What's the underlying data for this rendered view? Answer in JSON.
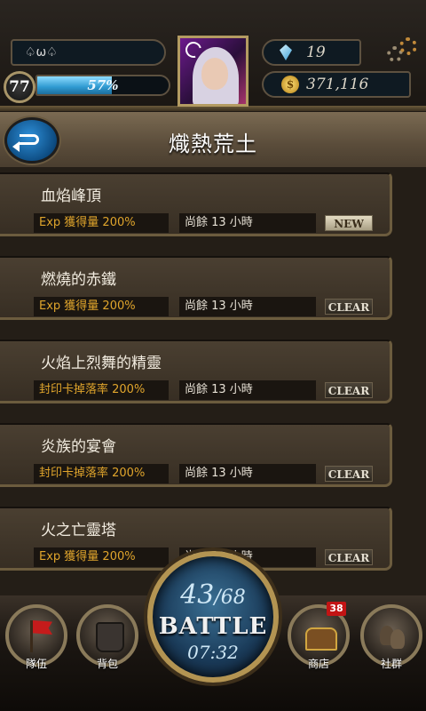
{
  "player": {
    "name": "♤ω♤",
    "level": "77",
    "exp_percent_text": "57%",
    "exp_fraction": 0.57,
    "gems": "19",
    "coins": "371,116"
  },
  "header": {
    "title": "熾熱荒土"
  },
  "quests": [
    {
      "name": "血焰峰頂",
      "reward": "Exp 獲得量 200%",
      "time": "尚餘 13 小時",
      "status": "NEW",
      "status_type": "new"
    },
    {
      "name": "燃燒的赤鐵",
      "reward": "Exp 獲得量 200%",
      "time": "尚餘 13 小時",
      "status": "CLEAR",
      "status_type": "clear"
    },
    {
      "name": "火焰上烈舞的精靈",
      "reward": "封印卡掉落率 200%",
      "time": "尚餘 13 小時",
      "status": "CLEAR",
      "status_type": "clear"
    },
    {
      "name": "炎族的宴會",
      "reward": "封印卡掉落率 200%",
      "time": "尚餘 13 小時",
      "status": "CLEAR",
      "status_type": "clear"
    },
    {
      "name": "火之亡靈塔",
      "reward": "Exp 獲得量 200%",
      "time": "尚餘 13 小時",
      "status": "CLEAR",
      "status_type": "clear"
    }
  ],
  "battle": {
    "current": "43",
    "max": "/68",
    "label": "BATTLE",
    "timer": "07:32"
  },
  "nav": {
    "team_label": "隊伍",
    "bag_label": "背包",
    "shop_label": "商店",
    "shop_badge": "38",
    "social_label": "社群"
  },
  "icons": {
    "back": "back-arrow-icon",
    "gem": "diamond-icon",
    "coin": "coin-icon",
    "settings": "gear-icon",
    "team": "red-flag-icon",
    "bag": "backpack-icon",
    "shop": "treasure-chest-icon",
    "social": "people-icon"
  },
  "colors": {
    "exp_bar": "#2f9ad1",
    "reward_text": "#e0a52c",
    "notif_badge": "#c21414",
    "back_button": "#1c6dae"
  }
}
